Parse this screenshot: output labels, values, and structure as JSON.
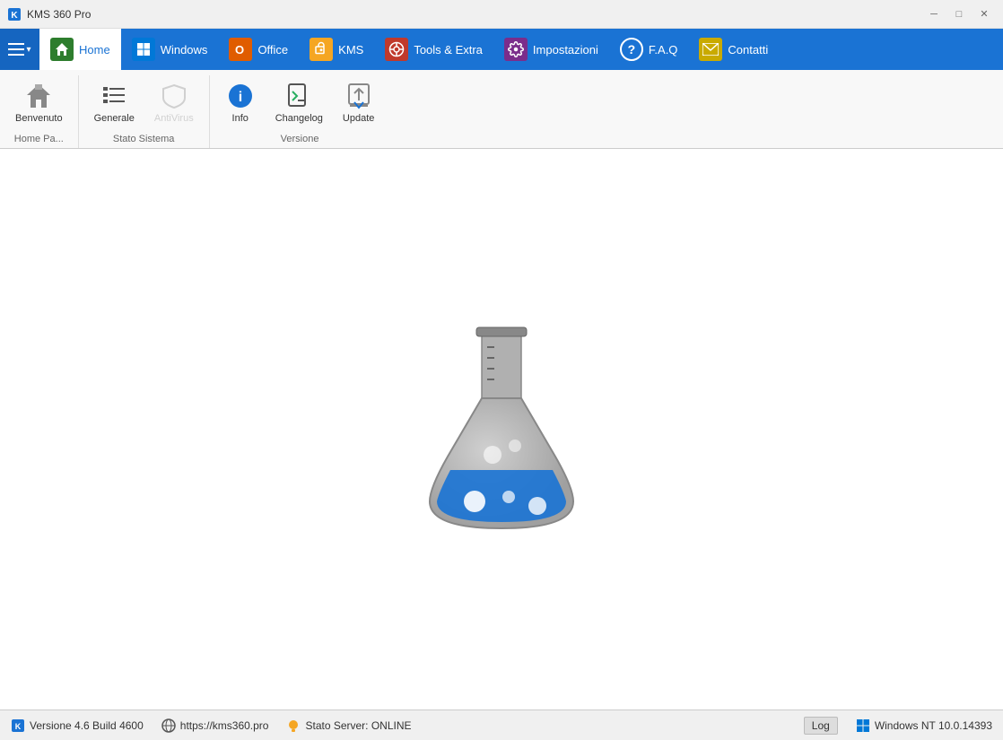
{
  "window": {
    "title": "KMS 360 Pro"
  },
  "nav": {
    "tabs": [
      {
        "id": "home",
        "label": "Home",
        "icon": "home",
        "active": true,
        "icon_color": "green"
      },
      {
        "id": "windows",
        "label": "Windows",
        "icon": "windows",
        "active": false,
        "icon_color": "blue-win"
      },
      {
        "id": "office",
        "label": "Office",
        "icon": "office",
        "active": false,
        "icon_color": "orange-off"
      },
      {
        "id": "kms",
        "label": "KMS",
        "icon": "kms",
        "active": false,
        "icon_color": "yellow-kms"
      },
      {
        "id": "tools",
        "label": "Tools & Extra",
        "icon": "tools",
        "active": false,
        "icon_color": "red-tools"
      },
      {
        "id": "impostazioni",
        "label": "Impostazioni",
        "icon": "settings",
        "active": false,
        "icon_color": "purple-imp"
      },
      {
        "id": "faq",
        "label": "F.A.Q",
        "icon": "faq",
        "active": false,
        "icon_color": "blue-faq"
      },
      {
        "id": "contatti",
        "label": "Contatti",
        "icon": "mail",
        "active": false,
        "icon_color": "yellow-cont"
      }
    ]
  },
  "ribbon": {
    "groups": [
      {
        "id": "home-page",
        "label": "Home Pa...",
        "buttons": [
          {
            "id": "benvenuto",
            "label": "Benvenuto",
            "icon": "house",
            "disabled": false
          }
        ]
      },
      {
        "id": "stato-sistema",
        "label": "Stato Sistema",
        "buttons": [
          {
            "id": "generale",
            "label": "Generale",
            "icon": "list",
            "disabled": false
          },
          {
            "id": "antivirus",
            "label": "AntiVirus",
            "icon": "shield",
            "disabled": true
          }
        ]
      },
      {
        "id": "versione",
        "label": "Versione",
        "buttons": [
          {
            "id": "info",
            "label": "Info",
            "icon": "info",
            "disabled": false
          },
          {
            "id": "changelog",
            "label": "Changelog",
            "icon": "changelog",
            "disabled": false
          },
          {
            "id": "update",
            "label": "Update",
            "icon": "upload",
            "disabled": false
          }
        ]
      }
    ]
  },
  "statusbar": {
    "version": "Versione 4.6 Build 4600",
    "website": "https://kms360.pro",
    "server_status": "Stato Server: ONLINE",
    "log_label": "Log",
    "os": "Windows NT 10.0.14393"
  }
}
